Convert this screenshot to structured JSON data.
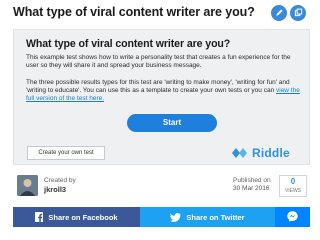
{
  "header": {
    "title": "What type of viral content writer are you?",
    "edit_icon": "pencil-icon",
    "copy_icon": "copy-icon",
    "accent": "#3a8ad8"
  },
  "card": {
    "title": "What type of viral content writer are you?",
    "description": "This example test shows how to write a personality test that creates a fun experience for the user so they will share it and spread your business message.",
    "description2_prefix": "The three possible results types for this test are 'writing to make money', 'writing for fun' and 'writing to educate'. You can use this as a template to create your own tests or you can ",
    "description2_link": "view the full version of the test here.",
    "start_label": "Start",
    "create_label": "Create your own test",
    "brand": "Riddle",
    "brand_color": "#2f93d6",
    "start_color": "#1f7fdd"
  },
  "author": {
    "created_label": "Created by",
    "name": "jkroll3",
    "published_label": "Published on",
    "published_date": "30 Mar 2016",
    "views_count": "0",
    "views_label": "VIEWS"
  },
  "share": {
    "facebook_label": "Share on Facebook",
    "twitter_label": "Share on Twitter",
    "facebook_color": "#3b5998",
    "twitter_color": "#1da1f2",
    "messenger_color": "#0084ff",
    "facebook_icon": "facebook-icon",
    "twitter_icon": "twitter-icon",
    "messenger_icon": "messenger-icon"
  }
}
